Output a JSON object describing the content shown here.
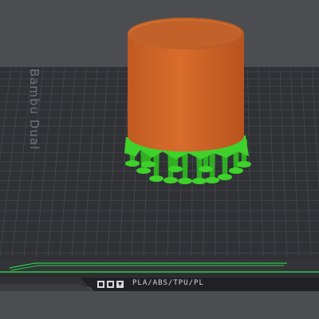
{
  "bed": {
    "label": "Bambu Dual ",
    "material_label": "PLA/ABS/TPU/PL"
  },
  "colors": {
    "background": "#4b4d50",
    "plate": "#2f3135",
    "grid_line": "#45484c",
    "model": "#d4672a",
    "support": "#3fd12c",
    "plate_edge_accent": "#2ec84c"
  },
  "icons": [
    "plate-logo-icon"
  ]
}
